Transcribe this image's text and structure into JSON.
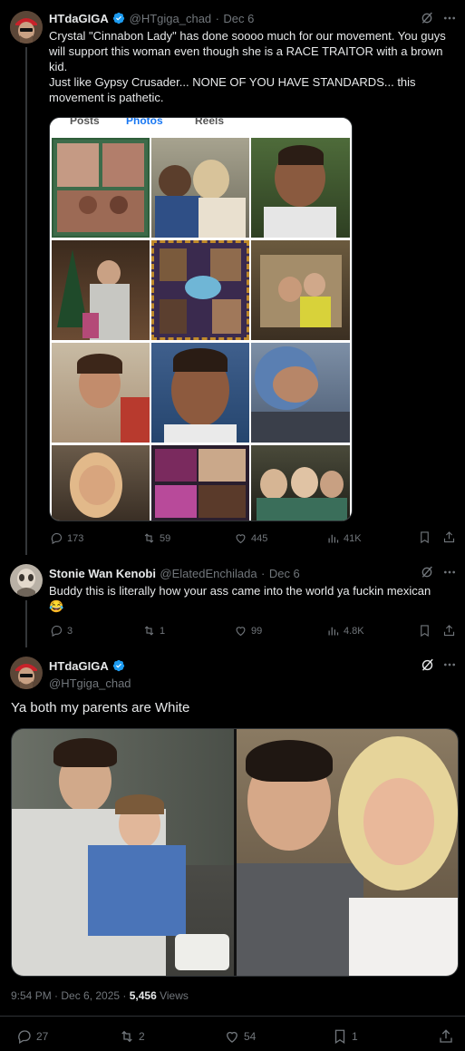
{
  "tweet1": {
    "name": "HTdaGIGA",
    "handle": "@HTgiga_chad",
    "dot": "·",
    "date": "Dec 6",
    "text_lines": [
      "Crystal \"Cinnabon Lady\" has done soooo much for our movement. You guys",
      "will support this woman even though she is a RACE TRAITOR with a brown",
      "kid.",
      "Just like Gypsy Crusader... NONE OF YOU HAVE STANDARDS... this",
      "movement is pathetic."
    ],
    "media_tab_labels": [
      "Posts",
      "Photos",
      "Reels"
    ],
    "replies": "173",
    "reposts": "59",
    "likes": "445",
    "views": "41K"
  },
  "tweet2": {
    "name": "Stonie Wan Kenobi",
    "handle": "@ElatedEnchilada",
    "dot": "·",
    "date": "Dec 6",
    "text": "Buddy this is literally how your ass came into the world ya fuckin mexican",
    "emoji": "😂",
    "replies": "3",
    "reposts": "1",
    "likes": "99",
    "views": "4.8K"
  },
  "main": {
    "name": "HTdaGIGA",
    "handle": "@HTgiga_chad",
    "text": "Ya both my parents are White",
    "time": "9:54 PM · Dec 6, 2025 · ",
    "view_count": "5,456",
    "views_label": " Views",
    "replies": "27",
    "reposts": "2",
    "likes": "54",
    "bookmarks": "1"
  },
  "colors": {
    "background": "#000000",
    "text": "#e7e9ea",
    "muted": "#71767b",
    "verified": "#1d9bf0",
    "divider": "#2f3336"
  },
  "icons": [
    "verified-badge-icon",
    "grok-icon",
    "more-icon",
    "reply-icon",
    "repost-icon",
    "like-icon",
    "views-icon",
    "bookmark-icon",
    "share-icon"
  ]
}
